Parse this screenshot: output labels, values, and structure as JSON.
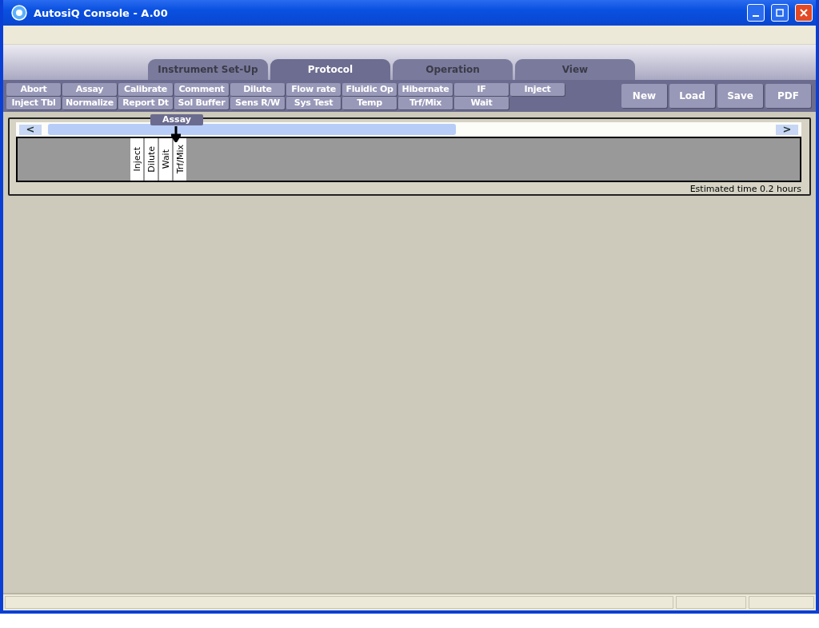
{
  "window": {
    "title": "AutosiQ Console - A.00"
  },
  "tabs": [
    {
      "label": "Instrument Set-Up",
      "selected": false
    },
    {
      "label": "Protocol",
      "selected": true
    },
    {
      "label": "Operation",
      "selected": false
    },
    {
      "label": "View",
      "selected": false
    }
  ],
  "commands": [
    [
      "Abort",
      "Assay",
      "Calibrate",
      "Comment",
      "Dilute",
      "Flow rate",
      "Fluidic Op",
      "Hibernate",
      "IF",
      "Inject"
    ],
    [
      "Inject Tbl",
      "Normalize",
      "Report Dt",
      "Sol Buffer",
      "Sens R/W",
      "Sys Test",
      "Temp",
      "Trf/Mix",
      "Wait"
    ]
  ],
  "file_buttons": [
    "New",
    "Load",
    "Save",
    "PDF"
  ],
  "drag_label": "Assay",
  "timeline": {
    "scroll_left": "<",
    "scroll_right": ">",
    "steps": [
      "Inject",
      "Dilute",
      "Wait",
      "Trf/Mix"
    ]
  },
  "estimated_time": "Estimated time  0.2 hours"
}
